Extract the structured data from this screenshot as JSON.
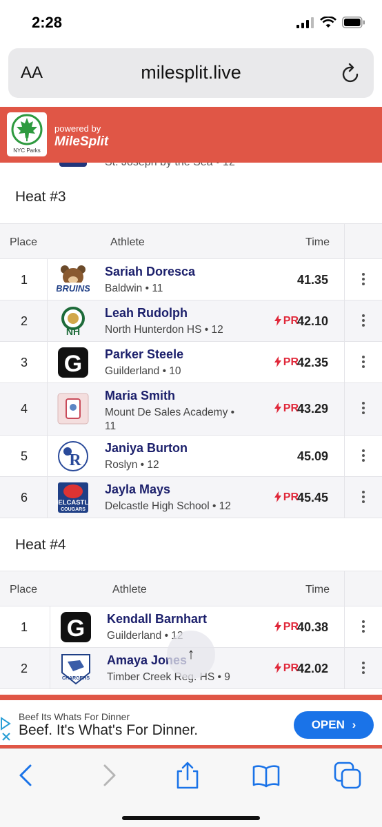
{
  "status": {
    "time": "2:28"
  },
  "browser": {
    "text_size": "AA",
    "url": "milesplit.live"
  },
  "header": {
    "parks_label": "NYC Parks",
    "powered_by": "powered by",
    "brand": "MileSplit"
  },
  "previous_row": {
    "school": "St. Joseph by the Sea • 12"
  },
  "heats": [
    {
      "title": "Heat #3",
      "columns": {
        "place": "Place",
        "athlete": "Athlete",
        "time": "Time"
      },
      "rows": [
        {
          "place": "1",
          "name": "Sariah Doresca",
          "school": "Baldwin • 11",
          "pr": "",
          "time": "41.35",
          "logo": "bruins-logo"
        },
        {
          "place": "2",
          "name": "Leah Rudolph",
          "school": "North Hunterdon HS • 12",
          "pr": "PR",
          "time": "42.10",
          "logo": "north-hunterdon-logo"
        },
        {
          "place": "3",
          "name": "Parker Steele",
          "school": "Guilderland • 10",
          "pr": "PR",
          "time": "42.35",
          "logo": "guilderland-logo"
        },
        {
          "place": "4",
          "name": "Maria Smith",
          "school": "Mount De Sales Academy • 11",
          "pr": "PR",
          "time": "43.29",
          "logo": "mount-de-sales-logo"
        },
        {
          "place": "5",
          "name": "Janiya Burton",
          "school": "Roslyn • 12",
          "pr": "",
          "time": "45.09",
          "logo": "roslyn-logo"
        },
        {
          "place": "6",
          "name": "Jayla Mays",
          "school": "Delcastle High School • 12",
          "pr": "PR",
          "time": "45.45",
          "logo": "delcastle-logo"
        }
      ]
    },
    {
      "title": "Heat #4",
      "columns": {
        "place": "Place",
        "athlete": "Athlete",
        "time": "Time"
      },
      "rows": [
        {
          "place": "1",
          "name": "Kendall Barnhart",
          "school": "Guilderland • 12",
          "pr": "PR",
          "time": "40.38",
          "logo": "guilderland-logo"
        },
        {
          "place": "2",
          "name": "Amaya Jones",
          "school": "Timber Creek Reg. HS • 9",
          "pr": "PR",
          "time": "42.02",
          "logo": "timber-creek-logo"
        }
      ]
    }
  ],
  "logo_text": {
    "bruins": "BRUINS",
    "north_hunterdon": "NH",
    "guilderland": "G",
    "roslyn": "R",
    "delcastle": "DELCASTLE",
    "delcastle_sub": "COUGARS",
    "timber_creek": "CHARGERS"
  },
  "ad": {
    "sponsor": "Beef Its Whats For Dinner",
    "headline": "Beef. It's What's For Dinner.",
    "cta": "OPEN"
  },
  "colors": {
    "header_red": "#e05646",
    "name_navy": "#1b1f6b",
    "pr_red": "#e0283a",
    "cta_blue": "#1a73e8",
    "ios_blue": "#1a73e8"
  }
}
